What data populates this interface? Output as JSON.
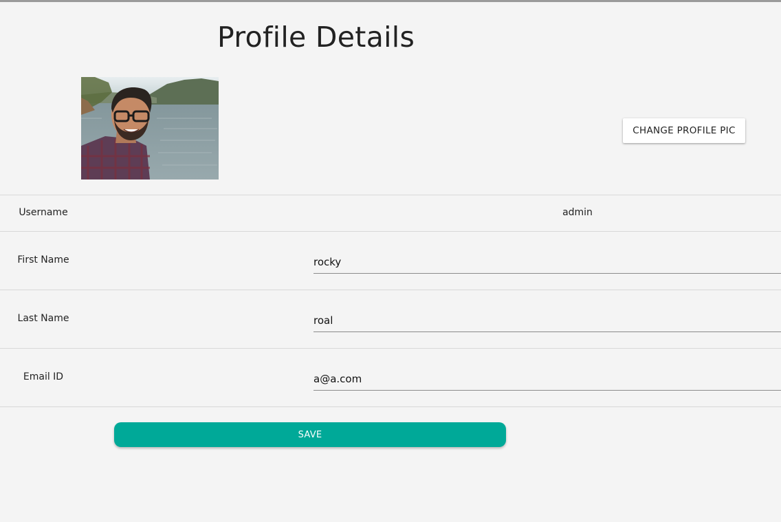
{
  "page": {
    "title": "Profile Details"
  },
  "profile_picture": {
    "alt": "profile-photo"
  },
  "actions": {
    "change_pic_label": "CHANGE PROFILE PIC",
    "save_label": "SAVE"
  },
  "fields": {
    "username": {
      "label": "Username",
      "value": "admin"
    },
    "first_name": {
      "label": "First Name",
      "value": "rocky"
    },
    "last_name": {
      "label": "Last Name",
      "value": "roal"
    },
    "email": {
      "label": "Email ID",
      "value": "a@a.com"
    }
  },
  "colors": {
    "background": "#f4f4f4",
    "accent": "#00a998",
    "divider": "#d8d8d8"
  }
}
